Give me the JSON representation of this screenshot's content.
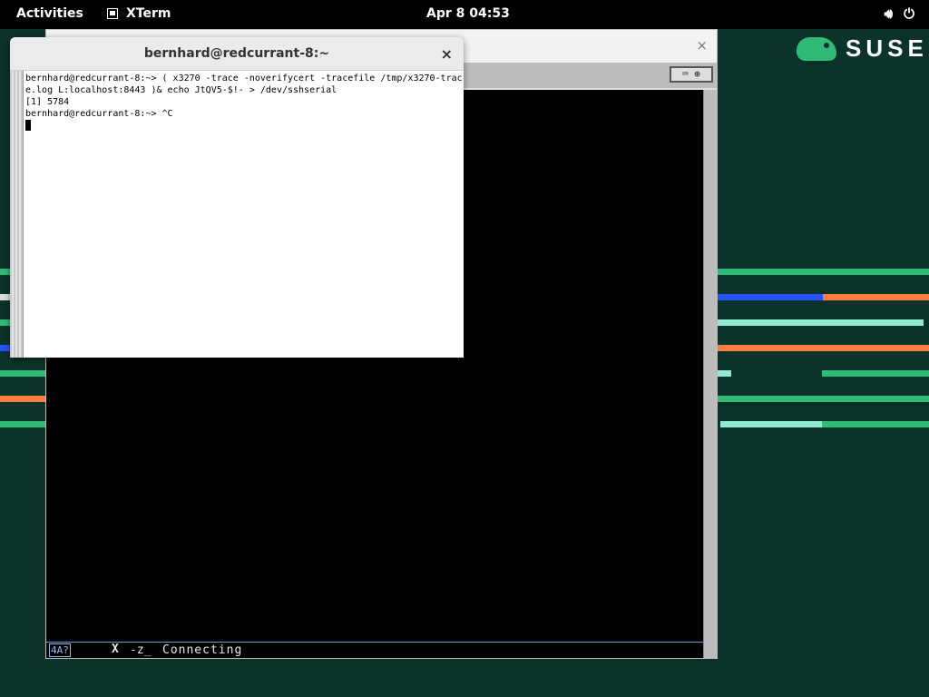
{
  "topbar": {
    "activities": "Activities",
    "app_name": "XTerm",
    "clock": "Apr 8  04:53",
    "volume_icon": "speaker-icon",
    "power_icon": "power-icon"
  },
  "desktop": {
    "logo_text": "SUSE"
  },
  "x3270": {
    "close_symbol": "×",
    "keyboard_icon": "keyboard-icon",
    "oia": {
      "indicator": "4A?",
      "x_symbol": "X",
      "clock_symbol": "-z_",
      "status": "Connecting"
    }
  },
  "xterm": {
    "title": "bernhard@redcurrant-8:~",
    "close_symbol": "×",
    "lines": [
      "bernhard@redcurrant-8:~> ( x3270 -trace -noverifycert -tracefile /tmp/x3270-trac",
      "e.log L:localhost:8443 )& echo JtQV5-$!- > /dev/sshserial",
      "[1] 5784",
      "bernhard@redcurrant-8:~> ^C"
    ]
  },
  "colors": {
    "desktop_bg": "#0c322c",
    "suse_green": "#30ba78",
    "stripe_orange": "#fe7c3f",
    "stripe_blue": "#2453ff",
    "stripe_mint": "#90ebcd"
  }
}
